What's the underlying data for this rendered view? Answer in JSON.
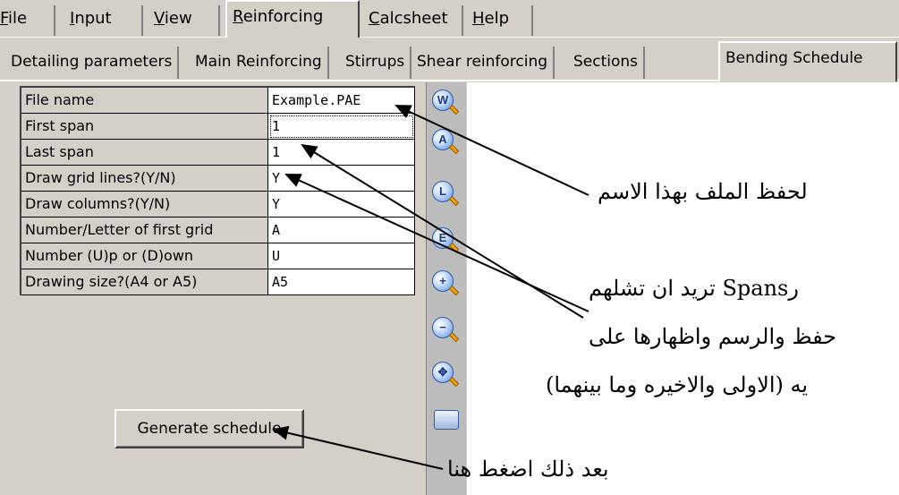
{
  "menu": {
    "tabs": [
      {
        "label": "File"
      },
      {
        "label": "Input"
      },
      {
        "label": "View"
      },
      {
        "label": "Reinforcing"
      },
      {
        "label": "Calcsheet"
      },
      {
        "label": "Help"
      }
    ],
    "active": "Reinforcing"
  },
  "subtabs": {
    "tabs": [
      {
        "label": "Detailing parameters"
      },
      {
        "label": "Main Reinforcing"
      },
      {
        "label": "Stirrups"
      },
      {
        "label": "Shear reinforcing"
      },
      {
        "label": "Sections"
      },
      {
        "label": "Bending Schedule"
      }
    ],
    "active": "Bending Schedule"
  },
  "params": [
    {
      "label": "File name",
      "value": "Example.PAE"
    },
    {
      "label": "First span",
      "value": "1"
    },
    {
      "label": "Last span",
      "value": "1"
    },
    {
      "label": "Draw grid lines?(Y/N)",
      "value": "Y"
    },
    {
      "label": "Draw columns?(Y/N)",
      "value": "Y"
    },
    {
      "label": "Number/Letter of first grid",
      "value": "A"
    },
    {
      "label": "Number (U)p or (D)own",
      "value": "U"
    },
    {
      "label": "Drawing size?(A4 or A5)",
      "value": "A5"
    }
  ],
  "generate_button": "Generate schedule",
  "tools": [
    {
      "icon": "zoom-window-icon",
      "letter": "W"
    },
    {
      "icon": "zoom-all-icon",
      "letter": "A"
    },
    {
      "icon": "zoom-last-icon",
      "letter": "L"
    },
    {
      "icon": "zoom-extents-icon",
      "letter": "E"
    },
    {
      "icon": "zoom-in-icon",
      "letter": "+"
    },
    {
      "icon": "zoom-out-icon",
      "letter": "−"
    },
    {
      "icon": "pan-icon",
      "letter": "✥"
    },
    {
      "icon": "printer-icon",
      "letter": ""
    }
  ],
  "annotations": {
    "file_name_note": "لحفظ الملف بهذا الاسم",
    "spans_line1": "رSpans تريد ان تشلهم",
    "spans_line2": "حفظ والرسم واظهارها على",
    "spans_line3": "يه (الاولى والاخيره وما بينهما)",
    "generate_note": "بعد ذلك اضغط هنا"
  }
}
